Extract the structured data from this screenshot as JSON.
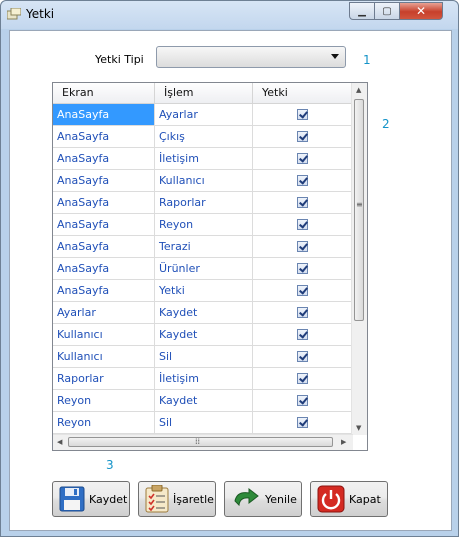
{
  "window": {
    "title": "Yetki"
  },
  "form": {
    "type_label": "Yetki Tipi",
    "type_value": "",
    "marker_1": "1",
    "marker_2": "2",
    "marker_3": "3"
  },
  "grid": {
    "columns": [
      "Ekran",
      "İşlem",
      "Yetki"
    ],
    "rows": [
      {
        "ekran": "AnaSayfa",
        "islem": "Ayarlar",
        "yetki": true
      },
      {
        "ekran": "AnaSayfa",
        "islem": "Çıkış",
        "yetki": true
      },
      {
        "ekran": "AnaSayfa",
        "islem": "İletişim",
        "yetki": true
      },
      {
        "ekran": "AnaSayfa",
        "islem": "Kullanıcı",
        "yetki": true
      },
      {
        "ekran": "AnaSayfa",
        "islem": "Raporlar",
        "yetki": true
      },
      {
        "ekran": "AnaSayfa",
        "islem": "Reyon",
        "yetki": true
      },
      {
        "ekran": "AnaSayfa",
        "islem": "Terazi",
        "yetki": true
      },
      {
        "ekran": "AnaSayfa",
        "islem": "Ürünler",
        "yetki": true
      },
      {
        "ekran": "AnaSayfa",
        "islem": "Yetki",
        "yetki": true
      },
      {
        "ekran": "Ayarlar",
        "islem": "Kaydet",
        "yetki": true
      },
      {
        "ekran": "Kullanıcı",
        "islem": "Kaydet",
        "yetki": true
      },
      {
        "ekran": "Kullanıcı",
        "islem": "Sil",
        "yetki": true
      },
      {
        "ekran": "Raporlar",
        "islem": "İletişim",
        "yetki": true
      },
      {
        "ekran": "Reyon",
        "islem": "Kaydet",
        "yetki": true
      },
      {
        "ekran": "Reyon",
        "islem": "Sil",
        "yetki": true
      }
    ],
    "selected_row": 0
  },
  "buttons": {
    "save": "Kaydet",
    "mark": "İşaretle",
    "refresh": "Yenile",
    "close": "Kapat"
  },
  "icons": [
    "window-app-icon",
    "minimize-icon",
    "maximize-icon",
    "close-icon",
    "dropdown-arrow-icon",
    "checkbox-icon",
    "floppy-disk-icon",
    "clipboard-checklist-icon",
    "refresh-arrow-icon",
    "power-icon"
  ],
  "colors": {
    "selection": "#3399ff",
    "link_text": "#2050b8",
    "marker": "#1493c8",
    "close_red": "#c7402b"
  }
}
